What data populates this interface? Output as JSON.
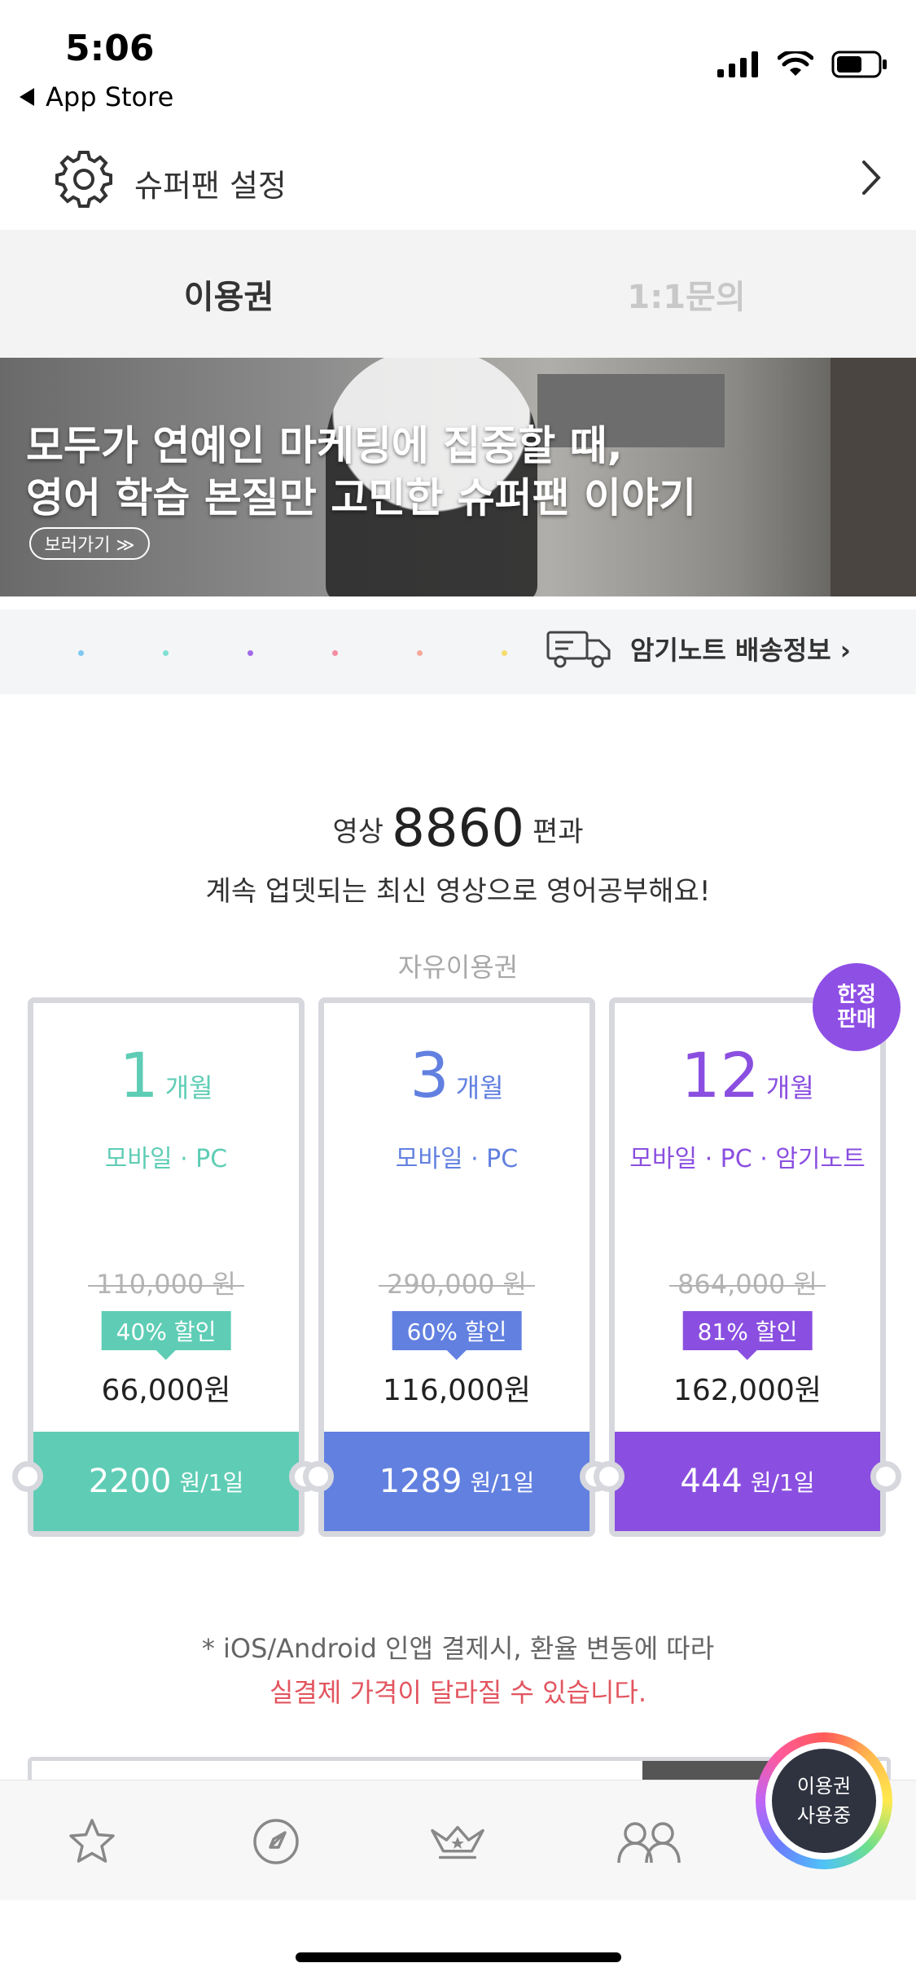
{
  "status_bar": {
    "time": "5:06",
    "back_app": "App Store"
  },
  "settings": {
    "label": "슈퍼팬 설정",
    "icon": "gear-icon"
  },
  "tabs": [
    {
      "label": "이용권",
      "active": true
    },
    {
      "label": "1:1문의",
      "active": false
    }
  ],
  "banner": {
    "line1": "모두가 연예인 마케팅에 집중할 때,",
    "line2": "영어 학습 본질만 고민한 슈퍼팬 이야기",
    "button": "보러가기 ≫"
  },
  "carousel_dots": [
    "#7ec8f2",
    "#7fe0d2",
    "#a36ae8",
    "#f28ca0",
    "#f5a89a",
    "#f5dc6e"
  ],
  "delivery_link": "암기노트 배송정보 ›",
  "headline": {
    "prefix": "영상",
    "count": "8860",
    "suffix": "편과",
    "line2": "계속 업뎃되는 최신 영상으로 영어공부해요!"
  },
  "plans_label": "자유이용권",
  "plans": [
    {
      "months": "1",
      "unit": "개월",
      "platforms": "모바일 · PC",
      "original": "110,000 원",
      "discount": "40% 할인",
      "price": "66,000원",
      "daily": "2200",
      "daily_unit": "원/1일",
      "color": "#5fcdb5"
    },
    {
      "months": "3",
      "unit": "개월",
      "platforms": "모바일 · PC",
      "original": "290,000 원",
      "discount": "60% 할인",
      "price": "116,000원",
      "daily": "1289",
      "daily_unit": "원/1일",
      "color": "#6280e0"
    },
    {
      "months": "12",
      "unit": "개월",
      "platforms": "모바일 · PC · 암기노트",
      "original": "864,000 원",
      "discount": "81% 할인",
      "price": "162,000원",
      "daily": "444",
      "daily_unit": "원/1일",
      "color": "#8a4fe0"
    }
  ],
  "limited_badge": {
    "line1": "한정",
    "line2": "판매"
  },
  "note": {
    "line1": "* iOS/Android 인앱 결제시, 환율 변동에 따라",
    "line2": "실결제 가격이 달라질 수 있습니다."
  },
  "bottom_nav": {
    "items": [
      "star-icon",
      "compass-icon",
      "crown-icon",
      "people-icon"
    ],
    "using": {
      "line1": "이용권",
      "line2": "사용중"
    }
  }
}
